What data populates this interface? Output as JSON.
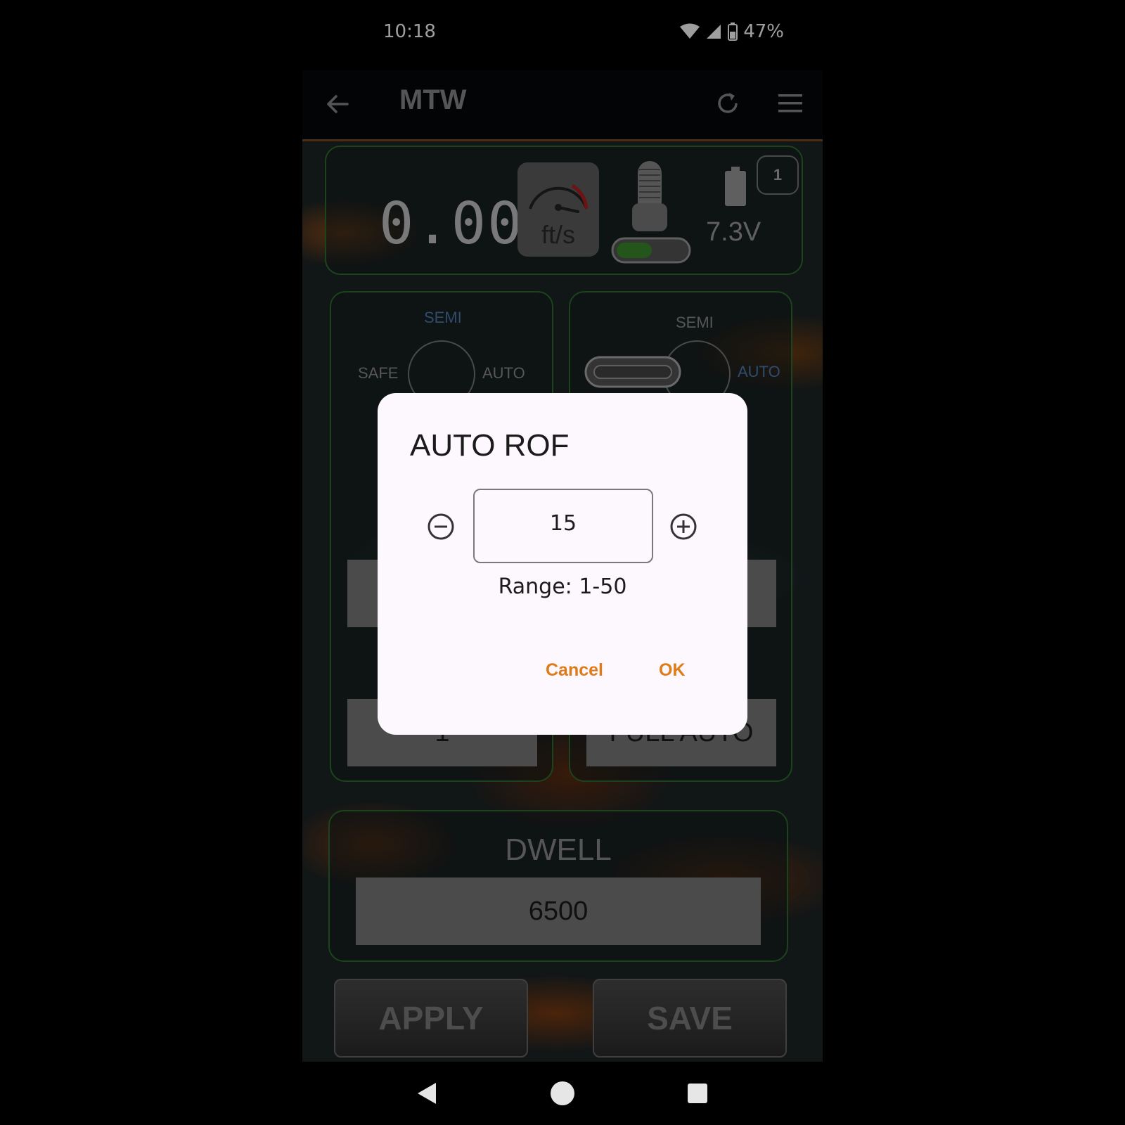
{
  "status_bar": {
    "time": "10:18",
    "battery": "47%"
  },
  "app_bar": {
    "title": "MTW"
  },
  "telemetry": {
    "speed": "0.00",
    "speed_unit": "ft/s",
    "voltage": "7.3V",
    "profile_badge": "1"
  },
  "selector_left": {
    "semi": "SEMI",
    "safe": "SAFE",
    "auto": "AUTO",
    "field_value": "1"
  },
  "selector_right": {
    "semi": "SEMI",
    "auto": "AUTO",
    "field_value": "FULL AUTO"
  },
  "dwell": {
    "label": "DWELL",
    "value": "6500"
  },
  "actions": {
    "apply": "APPLY",
    "save": "SAVE"
  },
  "dialog": {
    "title": "AUTO ROF",
    "value": "15",
    "range": "Range: 1-50",
    "cancel": "Cancel",
    "ok": "OK"
  },
  "colors": {
    "accent": "#e07b1a",
    "panel_border": "#2e6e2e",
    "active_label": "#4d79b0"
  },
  "icons": [
    "back-arrow-icon",
    "refresh-icon",
    "menu-icon",
    "wifi-icon",
    "cell-signal-icon",
    "battery-icon",
    "speedometer-icon",
    "trigger-icon",
    "minus-circle-icon",
    "plus-circle-icon",
    "nav-back-icon",
    "nav-home-icon",
    "nav-recents-icon"
  ]
}
